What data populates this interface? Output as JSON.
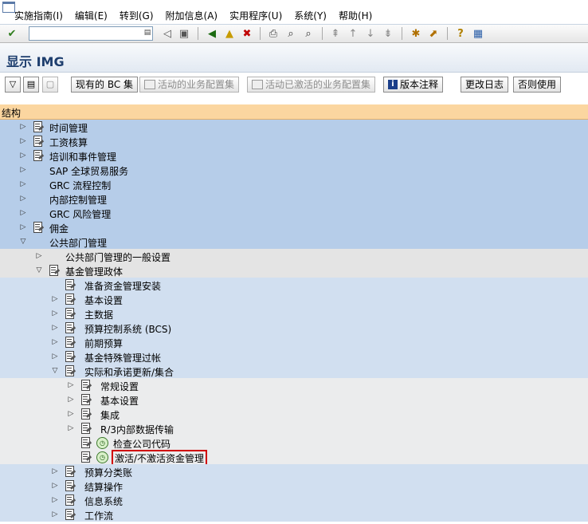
{
  "menu": [
    "实施指南(I)",
    "编辑(E)",
    "转到(G)",
    "附加信息(A)",
    "实用程序(U)",
    "系统(Y)",
    "帮助(H)"
  ],
  "command_field": {
    "value": ""
  },
  "title": "显示 IMG",
  "app_toolbar": {
    "bc_sets": "现有的 BC 集",
    "active_business_config": "活动的业务配置集",
    "active_activated_config": "活动已激活的业务配置集",
    "release_notes": "版本注释",
    "change_log": "更改日志",
    "usage": "否则使用"
  },
  "structure_header": "结构",
  "tree": [
    {
      "label": "时间管理",
      "level": 0,
      "toggle": "collapsed",
      "icon": "doc"
    },
    {
      "label": "工资核算",
      "level": 0,
      "toggle": "collapsed",
      "icon": "doc"
    },
    {
      "label": "培训和事件管理",
      "level": 0,
      "toggle": "collapsed",
      "icon": "doc"
    },
    {
      "label": "SAP 全球贸易服务",
      "level": 0,
      "toggle": "collapsed",
      "icon": "none"
    },
    {
      "label": "GRC 流程控制",
      "level": 0,
      "toggle": "collapsed",
      "icon": "none"
    },
    {
      "label": "内部控制管理",
      "level": 0,
      "toggle": "collapsed",
      "icon": "none"
    },
    {
      "label": "GRC 风险管理",
      "level": 0,
      "toggle": "collapsed",
      "icon": "none"
    },
    {
      "label": "佣金",
      "level": 0,
      "toggle": "collapsed",
      "icon": "doc"
    },
    {
      "label": "公共部门管理",
      "level": 0,
      "toggle": "expanded",
      "icon": "none"
    },
    {
      "label": "公共部门管理的一般设置",
      "level": 1,
      "toggle": "collapsed",
      "icon": "none"
    },
    {
      "label": "基金管理政体",
      "level": 1,
      "toggle": "expanded",
      "icon": "doc"
    },
    {
      "label": "准备资金管理安装",
      "level": 2,
      "toggle": "none",
      "icon": "doc"
    },
    {
      "label": "基本设置",
      "level": 2,
      "toggle": "collapsed",
      "icon": "doc"
    },
    {
      "label": "主数据",
      "level": 2,
      "toggle": "collapsed",
      "icon": "doc"
    },
    {
      "label": "预算控制系统 (BCS)",
      "level": 2,
      "toggle": "collapsed",
      "icon": "doc"
    },
    {
      "label": "前期预算",
      "level": 2,
      "toggle": "collapsed",
      "icon": "doc"
    },
    {
      "label": "基金特殊管理过帐",
      "level": 2,
      "toggle": "collapsed",
      "icon": "doc"
    },
    {
      "label": "实际和承诺更新/集合",
      "level": 2,
      "toggle": "expanded",
      "icon": "doc"
    },
    {
      "label": "常规设置",
      "level": 3,
      "toggle": "collapsed",
      "icon": "doc"
    },
    {
      "label": "基本设置",
      "level": 3,
      "toggle": "collapsed",
      "icon": "doc"
    },
    {
      "label": "集成",
      "level": 3,
      "toggle": "collapsed",
      "icon": "doc"
    },
    {
      "label": "R/3内部数据传输",
      "level": 3,
      "toggle": "collapsed",
      "icon": "doc"
    },
    {
      "label": "检查公司代码",
      "level": 3,
      "toggle": "none",
      "icon": "doc-clock"
    },
    {
      "label": "激活/不激活资金管理",
      "level": 3,
      "toggle": "none",
      "icon": "doc-clock",
      "selected": true
    },
    {
      "label": "预算分类账",
      "level": 2,
      "toggle": "collapsed",
      "icon": "doc"
    },
    {
      "label": "结算操作",
      "level": 2,
      "toggle": "collapsed",
      "icon": "doc"
    },
    {
      "label": "信息系统",
      "level": 2,
      "toggle": "collapsed",
      "icon": "doc"
    },
    {
      "label": "工作流",
      "level": 2,
      "toggle": "collapsed",
      "icon": "doc"
    }
  ]
}
